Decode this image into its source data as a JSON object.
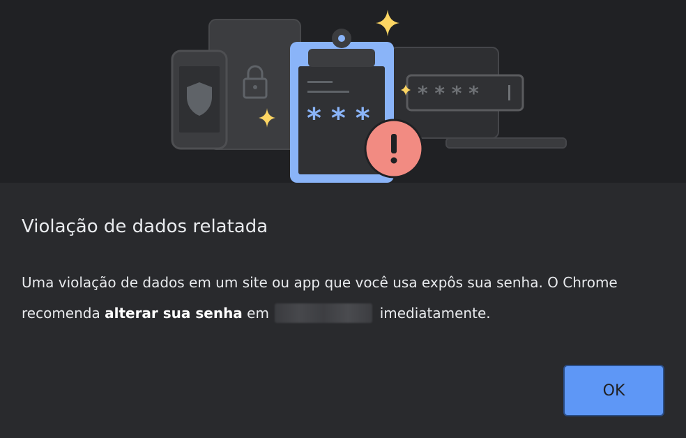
{
  "dialog": {
    "title": "Violação de dados relatada",
    "body_part1": "Uma violação de dados em um site ou app que você usa expôs sua senha. O Chrome recomenda ",
    "body_link": "alterar sua senha",
    "body_part2": " em",
    "body_part3": "imediatamente.",
    "ok_label": "OK"
  },
  "illustration": {
    "clipboard_password": "* * *",
    "field_password": "* * * *",
    "icons": [
      "phone-shield-icon",
      "tablet-lock-icon",
      "laptop-icon",
      "clipboard-icon",
      "warning-icon",
      "sparkle-icon"
    ]
  },
  "colors": {
    "background": "#292a2d",
    "illustration_bg": "#202124",
    "accent_blue": "#8ab4f8",
    "button_blue": "#5e97f6",
    "warning_red": "#f28b82",
    "sparkle_yellow": "#fdd663"
  }
}
